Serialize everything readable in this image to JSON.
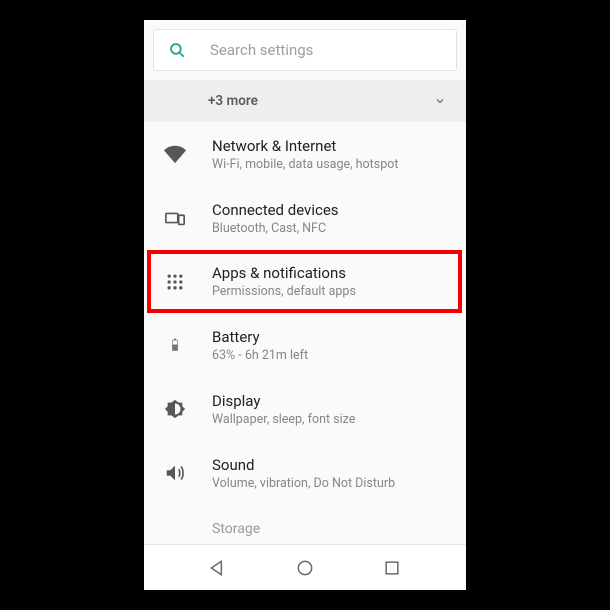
{
  "search": {
    "placeholder": "Search settings"
  },
  "suggestions": {
    "label": "+3 more"
  },
  "items": [
    {
      "title": "Network & Internet",
      "subtitle": "Wi-Fi, mobile, data usage, hotspot"
    },
    {
      "title": "Connected devices",
      "subtitle": "Bluetooth, Cast, NFC"
    },
    {
      "title": "Apps & notifications",
      "subtitle": "Permissions, default apps"
    },
    {
      "title": "Battery",
      "subtitle": "63% - 6h 21m left"
    },
    {
      "title": "Display",
      "subtitle": "Wallpaper, sleep, font size"
    },
    {
      "title": "Sound",
      "subtitle": "Volume, vibration, Do Not Disturb"
    },
    {
      "title": "Storage",
      "subtitle": ""
    }
  ]
}
